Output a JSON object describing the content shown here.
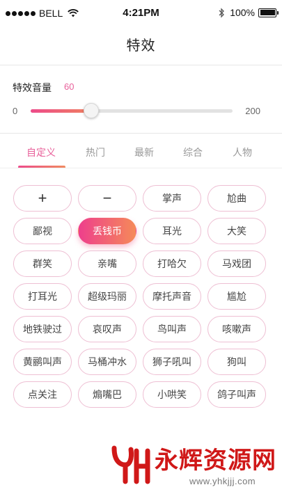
{
  "status_bar": {
    "carrier": "BELL",
    "time": "4:21PM",
    "battery": "100%"
  },
  "header": {
    "title": "特效"
  },
  "volume": {
    "label": "特效音量",
    "value": "60",
    "min_label": "0",
    "max_label": "200",
    "min": 0,
    "max": 200,
    "current": 60
  },
  "tabs": [
    {
      "label": "自定义",
      "active": true
    },
    {
      "label": "热门",
      "active": false
    },
    {
      "label": "最新",
      "active": false
    },
    {
      "label": "综合",
      "active": false
    },
    {
      "label": "人物",
      "active": false
    }
  ],
  "effects": [
    {
      "label": "+",
      "kind": "add-icon"
    },
    {
      "label": "−",
      "kind": "remove-icon"
    },
    {
      "label": "掌声"
    },
    {
      "label": "尬曲"
    },
    {
      "label": "鄙视"
    },
    {
      "label": "丢钱币",
      "selected": true
    },
    {
      "label": "耳光"
    },
    {
      "label": "大笑"
    },
    {
      "label": "群笑"
    },
    {
      "label": "亲嘴"
    },
    {
      "label": "打哈欠"
    },
    {
      "label": "马戏团"
    },
    {
      "label": "打耳光"
    },
    {
      "label": "超级玛丽"
    },
    {
      "label": "摩托声音"
    },
    {
      "label": "尴尬"
    },
    {
      "label": "地铁驶过"
    },
    {
      "label": "哀叹声"
    },
    {
      "label": "鸟叫声"
    },
    {
      "label": "咳嗽声"
    },
    {
      "label": "黄鹂叫声"
    },
    {
      "label": "马桶冲水"
    },
    {
      "label": "狮子吼叫"
    },
    {
      "label": "狗叫"
    },
    {
      "label": "点关注"
    },
    {
      "label": "煽嘴巴"
    },
    {
      "label": "小哄笑"
    },
    {
      "label": "鸽子叫声"
    }
  ],
  "watermark": {
    "title": "永辉资源网",
    "url": "www.yhkjjj.com"
  },
  "colors": {
    "accent": "#e8609a",
    "gradient_start": "#ee3f8c",
    "gradient_end": "#f58a59",
    "chip_border": "#eebfd3",
    "watermark_red": "#d01818"
  }
}
